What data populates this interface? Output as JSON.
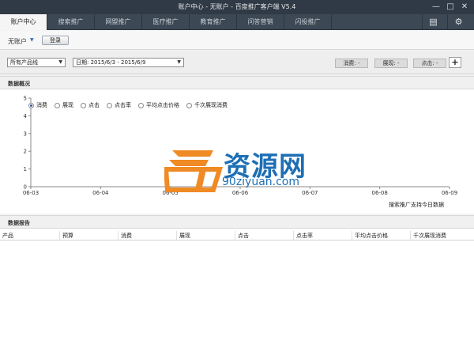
{
  "window": {
    "title": "账户中心 - 无账户 - 百度推广客户端 V5.4"
  },
  "tabs": [
    {
      "label": "账户中心",
      "active": true
    },
    {
      "label": "搜索推广",
      "active": false
    },
    {
      "label": "网盟推广",
      "active": false
    },
    {
      "label": "医疗推广",
      "active": false
    },
    {
      "label": "教育推广",
      "active": false
    },
    {
      "label": "问答营销",
      "active": false
    },
    {
      "label": "闪投推广",
      "active": false
    }
  ],
  "account": {
    "label": "无账户",
    "login_label": "登录"
  },
  "filters": {
    "product_line": "所有产品线",
    "date_range": "日期: 2015/6/3 - 2015/6/9",
    "metrics": [
      "消费: -",
      "展现: -",
      "点击: -"
    ],
    "add_label": "+"
  },
  "overview": {
    "title": "数据概况"
  },
  "legend": [
    "消费",
    "展现",
    "点击",
    "点击率",
    "平均点击价格",
    "千次展现消费"
  ],
  "chart_note": "搜索推广支持今日数据",
  "report": {
    "title": "数据报告",
    "columns": [
      "产品",
      "预算",
      "消费",
      "展现",
      "点击",
      "点击率",
      "平均点击价格",
      "千次展现消费"
    ]
  },
  "watermark": {
    "text": "资源网",
    "url": "90ziyuan.com",
    "logo": "90"
  },
  "chart_data": {
    "type": "line",
    "categories": [
      "06-03",
      "06-04",
      "06-05",
      "06-06",
      "06-07",
      "06-08",
      "06-09"
    ],
    "series": [],
    "yticks": [
      "0",
      "1",
      "2",
      "3",
      "4",
      "5"
    ],
    "ylim": [
      0,
      5
    ],
    "grid": true,
    "selected_metric": "消费"
  },
  "colors": {
    "accent": "#2a5fa8",
    "titlebar": "#2f3a46",
    "tabbar": "#3c4854",
    "watermark_blue": "#1d6fb5",
    "watermark_orange": "#f08a24"
  }
}
